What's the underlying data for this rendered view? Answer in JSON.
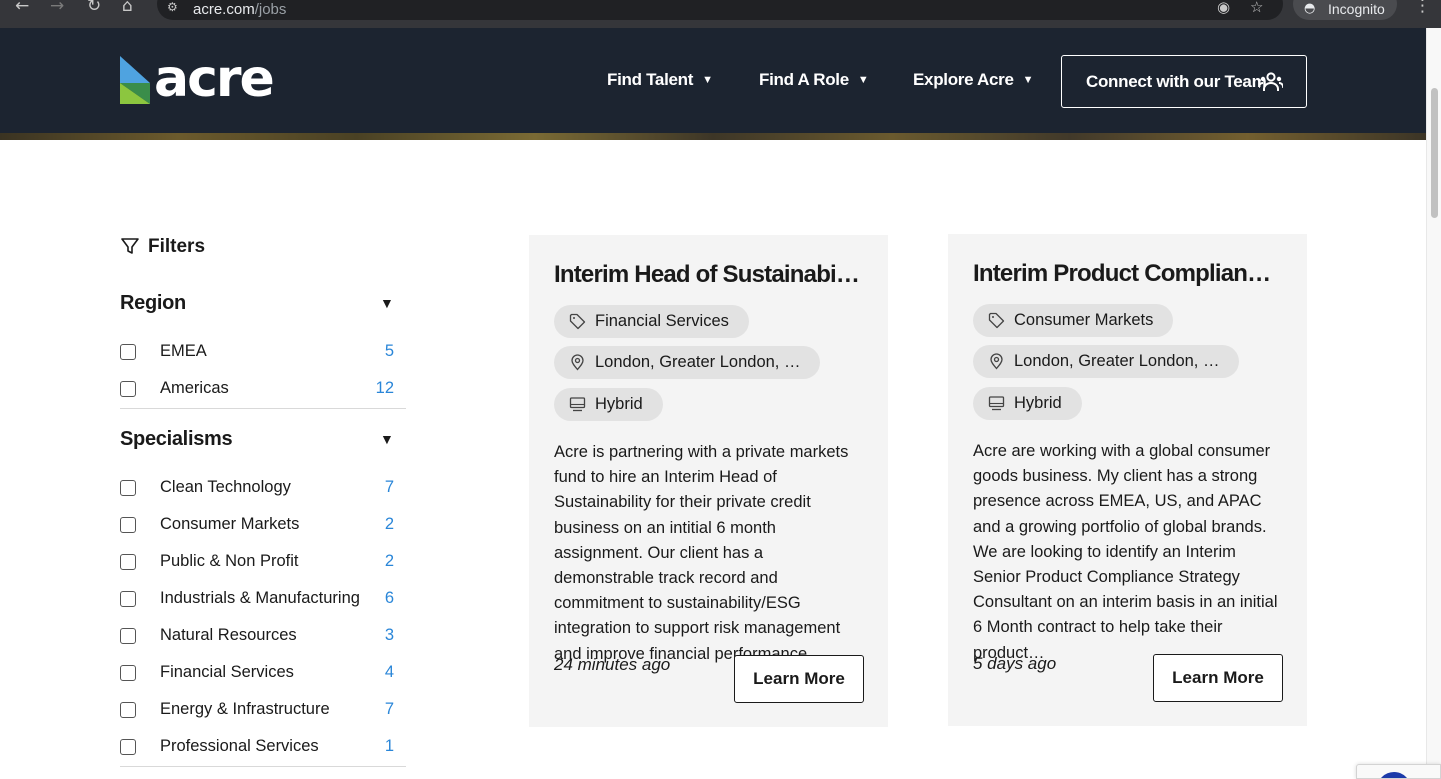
{
  "browser": {
    "url_domain": "acre.com",
    "url_path": "/jobs",
    "incognito_label": "Incognito"
  },
  "header": {
    "logo_text": "acre",
    "nav": [
      {
        "label": "Find Talent"
      },
      {
        "label": "Find A Role"
      },
      {
        "label": "Explore Acre"
      }
    ],
    "cta_label": "Connect with our Team"
  },
  "filters": {
    "title": "Filters",
    "region": {
      "title": "Region",
      "items": [
        {
          "label": "EMEA",
          "count": "5"
        },
        {
          "label": "Americas",
          "count": "12"
        }
      ]
    },
    "specialisms": {
      "title": "Specialisms",
      "items": [
        {
          "label": "Clean Technology",
          "count": "7"
        },
        {
          "label": "Consumer Markets",
          "count": "2"
        },
        {
          "label": "Public & Non Profit",
          "count": "2"
        },
        {
          "label": "Industrials & Manufacturing",
          "count": "6"
        },
        {
          "label": "Natural Resources",
          "count": "3"
        },
        {
          "label": "Financial Services",
          "count": "4"
        },
        {
          "label": "Energy & Infrastructure",
          "count": "7"
        },
        {
          "label": "Professional Services",
          "count": "1"
        }
      ]
    }
  },
  "jobs": [
    {
      "title": "Interim Head of Sustainabilit…",
      "specialism": "Financial Services",
      "location": "London, Greater London, …",
      "work_type": "Hybrid",
      "description": "Acre is partnering with a private markets fund to hire an Interim Head of Sustainability for their private credit business on an intitial 6 month assignment. Our client has a demonstrable track record and commitment to sustainability/ESG integration to support risk management and improve financial performance.…",
      "posted": "24 minutes ago",
      "cta": "Learn More"
    },
    {
      "title": "Interim Product Compliance…",
      "specialism": "Consumer Markets",
      "location": "London, Greater London, …",
      "work_type": "Hybrid",
      "description": "Acre are working with a global consumer goods business. My client has a strong presence across EMEA, US, and APAC and a growing portfolio of global brands. We are looking to identify an Interim Senior Product Compliance Strategy Consultant on an interim basis in an initial 6 Month contract to help take their product…",
      "posted": "5 days ago",
      "cta": "Learn More"
    }
  ]
}
